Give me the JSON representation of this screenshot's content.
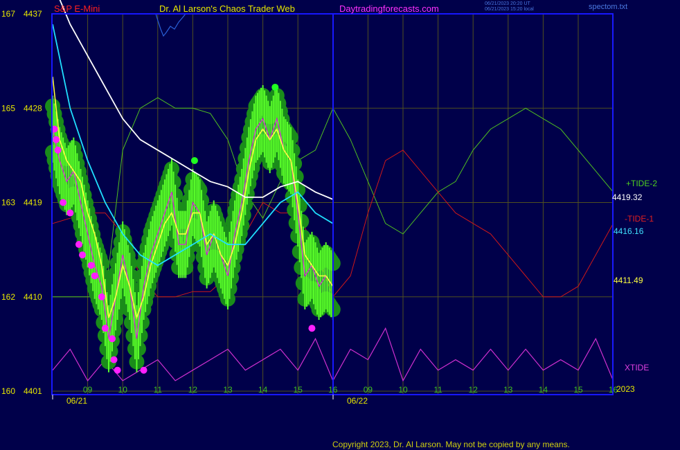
{
  "header": {
    "symbol": "S&P E-Mini",
    "title": "Dr. Al Larson's Chaos Trader Web",
    "site": "Daytradingforecasts.com",
    "timestamp_utc": "06/21/2023 20:20 UT",
    "timestamp_local": "06/21/2023 15:20 local",
    "file": "spectom.txt"
  },
  "copyright": "Copyright 2023, Dr. Al Larson. May not be copied by any means.",
  "colors": {
    "background": "#00004a",
    "frame": "#1818ff",
    "grid": "#505020",
    "header_red": "#ff2020",
    "header_yellow": "#e8e800",
    "header_magenta": "#ff30ff",
    "price_band": "#1a8c1a",
    "price_band_light": "#5aff2a",
    "price_avg": "#ffff40",
    "ma_fast": "#20e0ff",
    "ma_slow": "#ffffff",
    "tide2": "#50c020",
    "tide1": "#d01818",
    "xtide": "#d030d0",
    "markers_low": "#ff20ff",
    "markers_high": "#20ff20"
  },
  "chart_data": {
    "type": "line",
    "title": "S&P E-Mini",
    "left_axis_labels": [
      {
        "idx": "167",
        "price": "4437",
        "v": 4437
      },
      {
        "idx": "165",
        "price": "4428",
        "v": 4428
      },
      {
        "idx": "163",
        "price": "4419",
        "v": 4419
      },
      {
        "idx": "162",
        "price": "4410",
        "v": 4410
      },
      {
        "idx": "160",
        "price": "4401",
        "v": 4401
      }
    ],
    "ylim": [
      4401,
      4437
    ],
    "x_tick_labels": [
      {
        "label": "09",
        "day": 0
      },
      {
        "label": "10",
        "day": 0
      },
      {
        "label": "11",
        "day": 0
      },
      {
        "label": "12",
        "day": 0
      },
      {
        "label": "13",
        "day": 0
      },
      {
        "label": "14",
        "day": 0
      },
      {
        "label": "15",
        "day": 0
      },
      {
        "label": "16",
        "day": 0
      },
      {
        "label": "09",
        "day": 1
      },
      {
        "label": "10",
        "day": 1
      },
      {
        "label": "11",
        "day": 1
      },
      {
        "label": "12",
        "day": 1
      },
      {
        "label": "13",
        "day": 1
      },
      {
        "label": "14",
        "day": 1
      },
      {
        "label": "15",
        "day": 1
      },
      {
        "label": "16",
        "day": 1
      }
    ],
    "date_labels": [
      "06/21",
      "06/22"
    ],
    "year_label": "2023",
    "right_labels": [
      {
        "text": "+TIDE-2",
        "color": "#50d020"
      },
      {
        "text": "4419.32",
        "color": "#ffffff"
      },
      {
        "text": "-TIDE-1",
        "color": "#e02020"
      },
      {
        "text": "4416.16",
        "color": "#40e0ff"
      },
      {
        "text": "4411.49",
        "color": "#ffff40"
      },
      {
        "text": "XTIDE",
        "color": "#e040e0"
      }
    ],
    "series": [
      {
        "name": "price",
        "x": [
          8.0,
          8.2,
          8.4,
          8.6,
          8.8,
          9.0,
          9.2,
          9.4,
          9.6,
          9.8,
          10.0,
          10.2,
          10.4,
          10.6,
          10.8,
          11.0,
          11.2,
          11.4,
          11.6,
          11.8,
          12.0,
          12.2,
          12.4,
          12.6,
          12.8,
          13.0,
          13.2,
          13.4,
          13.6,
          13.8,
          14.0,
          14.2,
          14.4,
          14.6,
          14.8,
          15.0,
          15.2,
          15.4,
          15.6,
          15.8,
          16.0
        ],
        "y": [
          4426,
          4423,
          4421,
          4422,
          4419,
          4416,
          4413,
          4411,
          4406,
          4410,
          4414,
          4411,
          4406,
          4411,
          4414,
          4416,
          4418,
          4420,
          4415,
          4415,
          4419,
          4418,
          4414,
          4416,
          4414,
          4412,
          4416,
          4419,
          4423,
          4426,
          4427,
          4425,
          4427,
          4424,
          4423,
          4418,
          4412,
          4413,
          4411,
          4412,
          4411
        ]
      },
      {
        "name": "avg",
        "x": [
          8.0,
          8.2,
          8.4,
          8.6,
          8.8,
          9.0,
          9.2,
          9.4,
          9.6,
          9.8,
          10.0,
          10.2,
          10.4,
          10.6,
          10.8,
          11.0,
          11.2,
          11.4,
          11.6,
          11.8,
          12.0,
          12.2,
          12.4,
          12.6,
          12.8,
          13.0,
          13.2,
          13.4,
          13.6,
          13.8,
          14.0,
          14.2,
          14.4,
          14.6,
          14.8,
          15.0,
          15.2,
          15.4,
          15.6,
          15.8,
          16.0
        ],
        "y": [
          4431,
          4425,
          4423,
          4422,
          4421,
          4418,
          4416,
          4413,
          4408,
          4410,
          4413,
          4411,
          4408,
          4410,
          4413,
          4415,
          4417,
          4418,
          4416,
          4416,
          4418,
          4418,
          4415,
          4416,
          4414,
          4413,
          4415,
          4418,
          4422,
          4425,
          4426,
          4425,
          4426,
          4424,
          4423,
          4419,
          4414,
          4413,
          4412,
          4412,
          4411
        ]
      },
      {
        "name": "ma_fast",
        "x": [
          8.0,
          8.5,
          9.0,
          9.5,
          10.0,
          10.5,
          11.0,
          11.5,
          12.0,
          12.5,
          13.0,
          13.5,
          14.0,
          14.5,
          15.0,
          15.5,
          16.0
        ],
        "y": [
          4436,
          4428,
          4423,
          4419,
          4416,
          4414,
          4413,
          4414,
          4415,
          4416,
          4415,
          4415,
          4417,
          4419,
          4420,
          4418,
          4417
        ]
      },
      {
        "name": "ma_slow",
        "x": [
          8.0,
          8.5,
          9.0,
          9.5,
          10.0,
          10.5,
          11.0,
          11.5,
          12.0,
          12.5,
          13.0,
          13.5,
          14.0,
          14.5,
          15.0,
          15.5,
          16.0
        ],
        "y": [
          4440,
          4436,
          4433,
          4430,
          4427,
          4425,
          4424,
          4423,
          4422,
          4421,
          4420.5,
          4419.5,
          4419.5,
          4420.5,
          4421,
          4420,
          4419.3
        ]
      },
      {
        "name": "+TIDE-2",
        "x": [
          8.0,
          8.5,
          9.0,
          9.5,
          10.0,
          10.5,
          11.0,
          11.5,
          12.0,
          12.5,
          13.0,
          13.5,
          14.0,
          14.5,
          15.0,
          15.5,
          16.0,
          16.5,
          17.0,
          17.5,
          18.0,
          18.5,
          19.0,
          19.5,
          20.0,
          20.5,
          21.0,
          21.5,
          22.0,
          22.5,
          23.0,
          23.5,
          24.0
        ],
        "y": [
          4410,
          4410,
          4410,
          4410,
          4424,
          4428,
          4429,
          4428,
          4428,
          4427.5,
          4425,
          4420,
          4417.5,
          4421,
          4423,
          4424,
          4428,
          4425,
          4421,
          4417,
          4416,
          4418,
          4420,
          4421,
          4424,
          4426,
          4427,
          4428,
          4427,
          4426,
          4424,
          4422,
          4420
        ]
      },
      {
        "name": "-TIDE-1",
        "x": [
          8.0,
          8.5,
          9.0,
          9.5,
          10.0,
          10.5,
          11.0,
          11.5,
          12.0,
          12.5,
          13.0,
          13.5,
          14.0,
          14.5,
          15.0,
          15.5,
          16.0,
          16.5,
          17.0,
          17.5,
          18.0,
          18.5,
          19.0,
          19.5,
          20.0,
          20.5,
          21.0,
          21.5,
          22.0,
          22.5,
          23.0,
          23.5,
          24.0
        ],
        "y": [
          4417,
          4417.5,
          4418,
          4418,
          4416,
          4412,
          4410,
          4410,
          4410.5,
          4410.5,
          4412,
          4416,
          4419,
          4418,
          4418,
          4414.5,
          4410,
          4412,
          4418,
          4423,
          4424,
          4422,
          4420,
          4418,
          4417,
          4416,
          4414,
          4412,
          4410,
          4410,
          4411,
          4414,
          4417
        ]
      },
      {
        "name": "XTIDE",
        "x": [
          8.0,
          8.5,
          9.0,
          9.5,
          10.0,
          10.5,
          11.0,
          11.5,
          12.0,
          12.5,
          13.0,
          13.5,
          14.0,
          14.5,
          15.0,
          15.5,
          16.0,
          16.5,
          17.0,
          17.5,
          18.0,
          18.5,
          19.0,
          19.5,
          20.0,
          20.5,
          21.0,
          21.5,
          22.0,
          22.5,
          23.0,
          23.5,
          24.0
        ],
        "y": [
          4403,
          4405,
          4402,
          4404,
          4402,
          4403,
          4404,
          4402,
          4403,
          4404,
          4405,
          4403,
          4404,
          4405,
          4403,
          4406,
          4402,
          4405,
          4404,
          4407,
          4402,
          4405,
          4403,
          4404,
          4403,
          4405,
          4403,
          4405,
          4403,
          4404,
          4403,
          4406,
          4402
        ]
      }
    ],
    "low_markers": {
      "x": [
        8.05,
        8.1,
        8.15,
        8.3,
        8.5,
        8.75,
        8.85,
        9.1,
        9.2,
        9.4,
        9.5,
        9.7,
        9.75,
        9.85,
        10.6,
        15.4
      ],
      "y": [
        4426,
        4425,
        4424,
        4419,
        4418,
        4415,
        4414,
        4413,
        4412,
        4410,
        4407,
        4406,
        4404,
        4403,
        4403,
        4407
      ]
    },
    "high_markers": {
      "x": [
        12.05,
        14.35
      ],
      "y": [
        4423,
        4430
      ]
    }
  }
}
